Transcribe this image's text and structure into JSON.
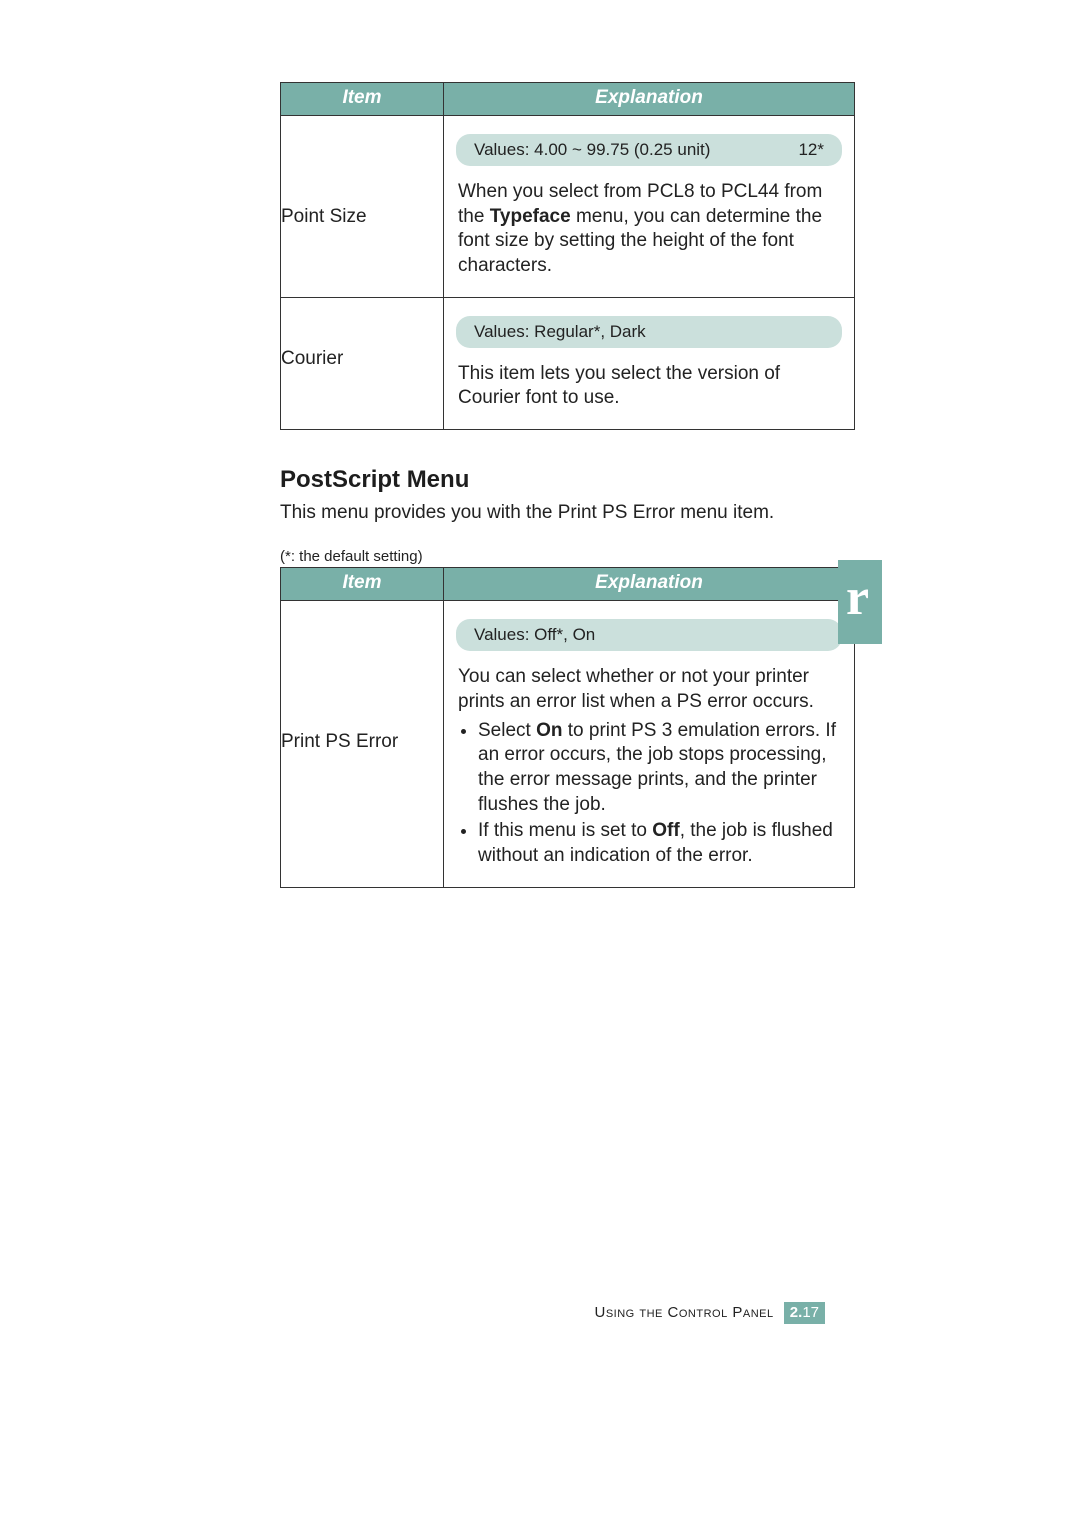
{
  "colors": {
    "accent": "#79b0a8",
    "pill": "#cbe0dc"
  },
  "table1": {
    "headers": {
      "item": "Item",
      "explanation": "Explanation"
    },
    "rows": [
      {
        "item": "Point Size",
        "values_left": "Values: 4.00 ~ 99.75 (0.25 unit)",
        "values_right": "12*",
        "explanation_html": "When you select from PCL8 to PCL44 from the <b>Typeface</b> menu, you can determine the font size by setting the height of the font characters."
      },
      {
        "item": "Courier",
        "values_left": "Values: Regular*, Dark",
        "values_right": "",
        "explanation_html": "This item lets you select the version of Courier font to use."
      }
    ]
  },
  "section": {
    "heading": "PostScript Menu",
    "intro": "This menu provides you with the Print PS Error menu item.",
    "default_note": "(*: the default setting)"
  },
  "table2": {
    "headers": {
      "item": "Item",
      "explanation": "Explanation"
    },
    "rows": [
      {
        "item": "Print PS Error",
        "values_left": "Values: Off*, On",
        "values_right": "",
        "explanation_html": "You can select whether or not your printer prints an error list when a PS error occurs.<ul><li>Select <b>On</b> to print PS 3 emulation errors. If an error occurs, the job stops processing, the error message prints, and the printer flushes the job.</li><li>If this menu is set to <b>Off</b>, the job is flushed without an indication of the error.</li></ul>"
      }
    ]
  },
  "side_tab_glyph": "r",
  "footer": {
    "label": "Using the Control Panel",
    "page_section": "2.",
    "page_num": "17"
  }
}
